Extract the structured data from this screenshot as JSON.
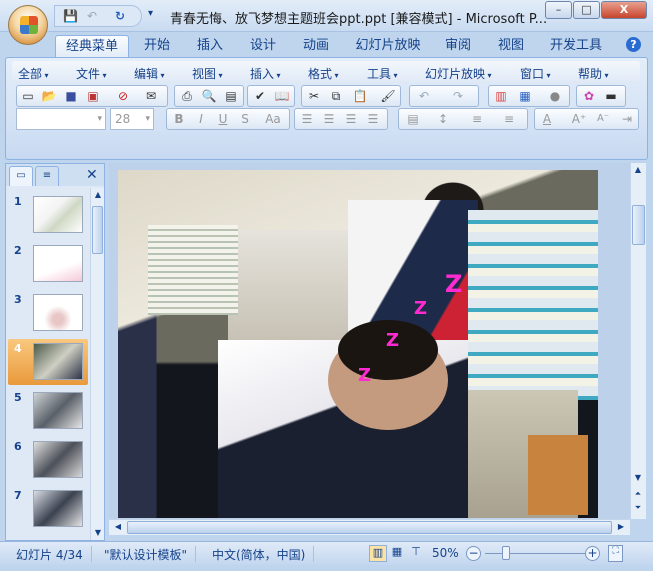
{
  "window": {
    "title": "青春无悔、放飞梦想主题班会ppt.ppt [兼容模式] - Microsoft P...",
    "min": "–",
    "max": "□",
    "close": "X"
  },
  "qat": {
    "save": "💾",
    "undo": "↶",
    "redo": "↻",
    "customize": "▾"
  },
  "tabs": [
    "经典菜单",
    "开始",
    "插入",
    "设计",
    "动画",
    "幻灯片放映",
    "审阅",
    "视图",
    "开发工具"
  ],
  "help_icon": "?",
  "menus": [
    "全部",
    "文件",
    "编辑",
    "视图",
    "插入",
    "格式",
    "工具",
    "幻灯片放映",
    "窗口",
    "帮助"
  ],
  "font": {
    "name": "",
    "size": "28"
  },
  "format_buttons": [
    "B",
    "I",
    "U",
    "S",
    "Aa"
  ],
  "slides": {
    "current": 4,
    "numbers": [
      "1",
      "2",
      "3",
      "4",
      "5",
      "6",
      "7"
    ]
  },
  "slide_content": {
    "z_marks": [
      "Z",
      "Z",
      "Z",
      "Z"
    ]
  },
  "status": {
    "slide": "幻灯片 4/34",
    "theme": "\"默认设计模板\"",
    "language": "中文(简体，中国)",
    "zoom": "50%",
    "zoom_fraction": 0.5
  }
}
